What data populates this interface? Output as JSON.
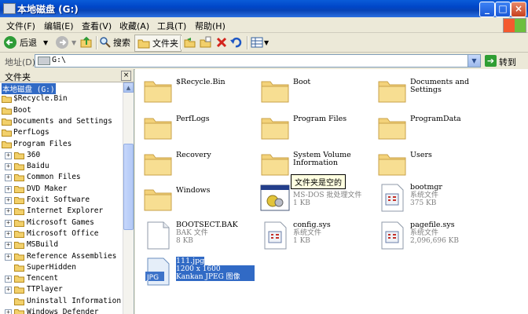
{
  "window": {
    "title": "本地磁盘 (G:)"
  },
  "menu": [
    "文件(F)",
    "编辑(E)",
    "查看(V)",
    "收藏(A)",
    "工具(T)",
    "帮助(H)"
  ],
  "toolbar": {
    "back": "后退",
    "search": "搜索",
    "folders": "文件夹"
  },
  "address": {
    "label": "地址(D)",
    "value": "G:\\",
    "go": "转到"
  },
  "folder_pane": {
    "title": "文件夹",
    "tree": [
      {
        "label": "本地磁盘 (G:)",
        "level": 0,
        "expander": "",
        "selected": true
      },
      {
        "label": "$Recycle.Bin",
        "level": 1,
        "expander": ""
      },
      {
        "label": "Boot",
        "level": 1,
        "expander": ""
      },
      {
        "label": "Documents and Settings",
        "level": 1,
        "expander": ""
      },
      {
        "label": "PerfLogs",
        "level": 1,
        "expander": ""
      },
      {
        "label": "Program Files",
        "level": 1,
        "expander": ""
      },
      {
        "label": "360",
        "level": 2,
        "expander": "+"
      },
      {
        "label": "Baidu",
        "level": 2,
        "expander": "+"
      },
      {
        "label": "Common Files",
        "level": 2,
        "expander": "+"
      },
      {
        "label": "DVD Maker",
        "level": 2,
        "expander": "+"
      },
      {
        "label": "Foxit Software",
        "level": 2,
        "expander": "+"
      },
      {
        "label": "Internet Explorer",
        "level": 2,
        "expander": "+"
      },
      {
        "label": "Microsoft Games",
        "level": 2,
        "expander": "+"
      },
      {
        "label": "Microsoft Office",
        "level": 2,
        "expander": "+"
      },
      {
        "label": "MSBuild",
        "level": 2,
        "expander": "+"
      },
      {
        "label": "Reference Assemblies",
        "level": 2,
        "expander": "+"
      },
      {
        "label": "SuperHidden",
        "level": 2,
        "expander": ""
      },
      {
        "label": "Tencent",
        "level": 2,
        "expander": "+"
      },
      {
        "label": "TTPlayer",
        "level": 2,
        "expander": "+"
      },
      {
        "label": "Uninstall Information",
        "level": 2,
        "expander": ""
      },
      {
        "label": "Windows Defender",
        "level": 2,
        "expander": "+"
      }
    ]
  },
  "items": [
    {
      "name": "$Recycle.Bin",
      "kind": "folder"
    },
    {
      "name": "Boot",
      "kind": "folder"
    },
    {
      "name": "Documents and Settings",
      "kind": "folder"
    },
    {
      "name": "PerfLogs",
      "kind": "folder"
    },
    {
      "name": "Program Files",
      "kind": "folder"
    },
    {
      "name": "ProgramData",
      "kind": "folder"
    },
    {
      "name": "Recovery",
      "kind": "folder"
    },
    {
      "name": "System Volume Information",
      "kind": "folder"
    },
    {
      "name": "Users",
      "kind": "folder"
    },
    {
      "name": "Windows",
      "kind": "folder"
    },
    {
      "name": "autoexec.bat",
      "kind": "bat",
      "type": "MS-DOS 批处理文件",
      "size": "1 KB"
    },
    {
      "name": "bootmgr",
      "kind": "sys",
      "type": "系统文件",
      "size": "375 KB"
    },
    {
      "name": "BOOTSECT.BAK",
      "kind": "blank",
      "type": "BAK 文件",
      "size": "8 KB"
    },
    {
      "name": "config.sys",
      "kind": "sys",
      "type": "系统文件",
      "size": "1 KB"
    },
    {
      "name": "pagefile.sys",
      "kind": "sys",
      "type": "系统文件",
      "size": "2,096,696 KB"
    },
    {
      "name": "111.jpg",
      "kind": "jpg",
      "type": "1200 x 1600",
      "size": "Kankan JPEG 图像",
      "selected": true
    }
  ],
  "tooltip": "文件夹是空的"
}
